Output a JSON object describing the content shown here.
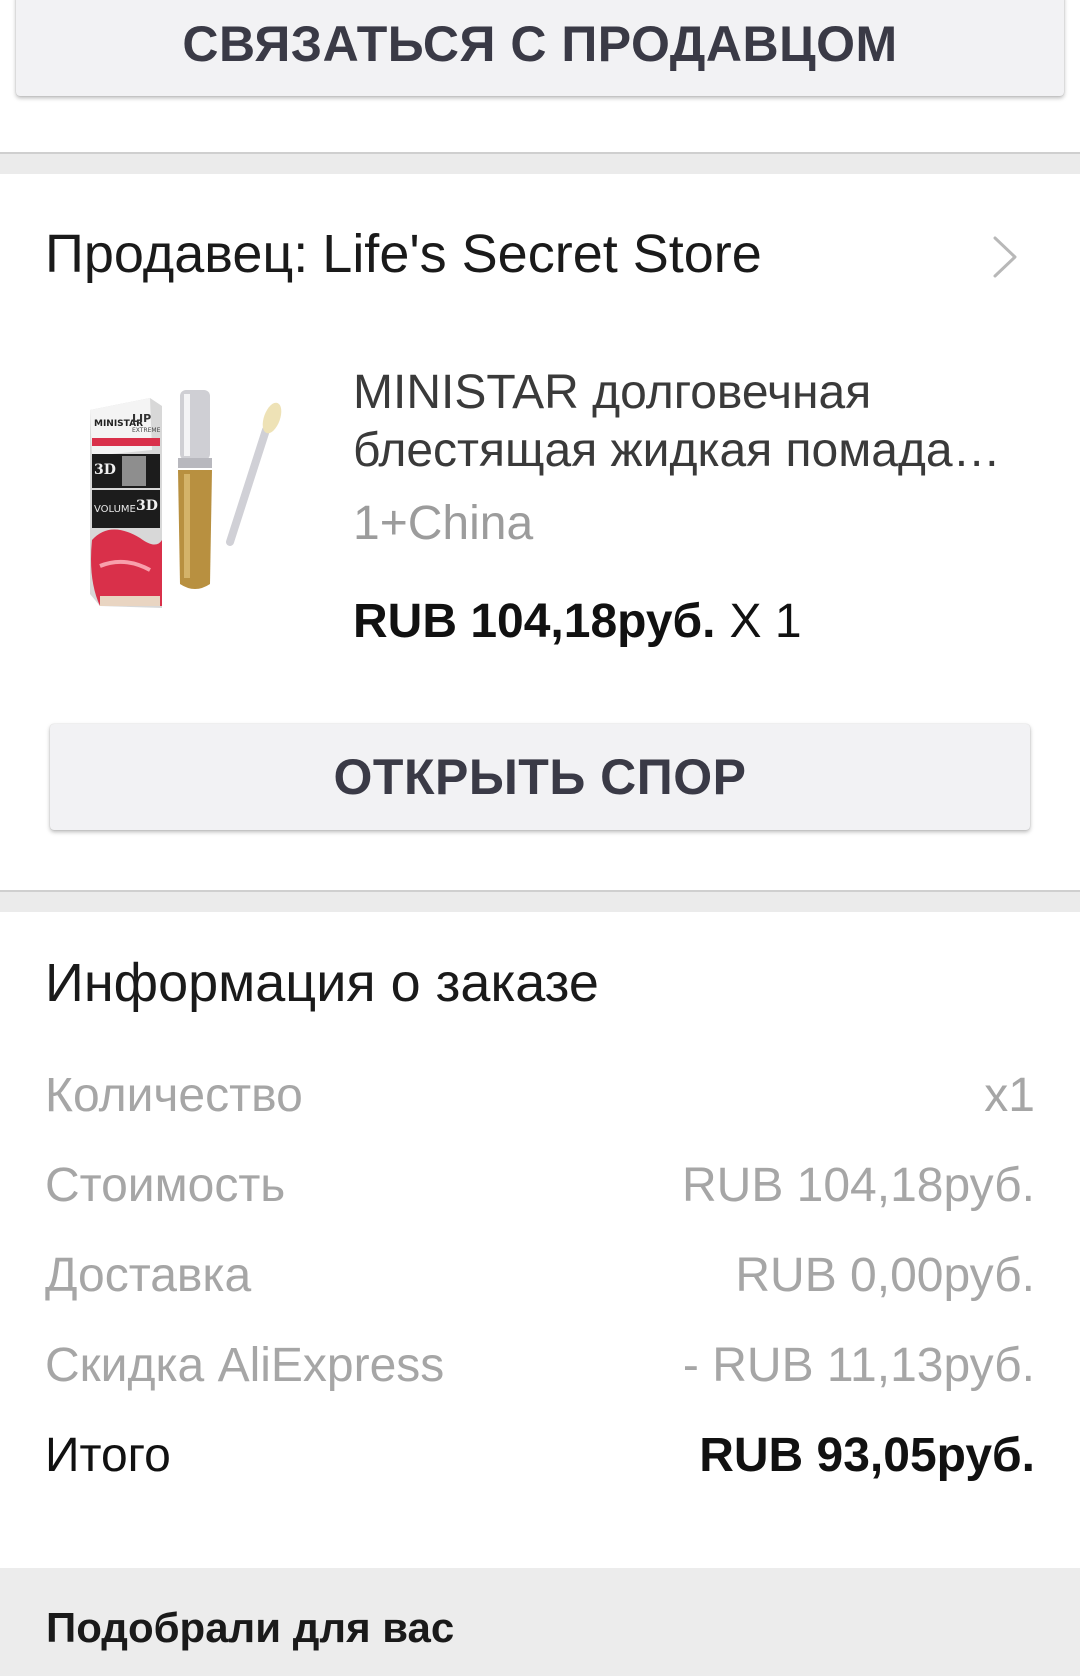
{
  "contact": {
    "button_label": "СВЯЗАТЬСЯ С ПРОДАВЦОМ"
  },
  "seller": {
    "prefix": "Продавец:",
    "name": "Life's Secret Store",
    "chevron_icon": "chevron-right-icon"
  },
  "product": {
    "image_icon": "product-thumbnail",
    "image_text": [
      "MINISTAR",
      "LIP",
      "EXTREME",
      "VOLUME",
      "3D"
    ],
    "title": "MINISTAR долговечная блестящая жидкая помада для губ с эффектом объема",
    "variant": "1+China",
    "price": "RUB 104,18руб.",
    "quantity": "X 1"
  },
  "dispute": {
    "button_label": "ОТКРЫТЬ СПОР"
  },
  "order_info": {
    "title": "Информация о заказе",
    "rows": [
      {
        "label": "Количество",
        "value": "x1"
      },
      {
        "label": "Стоимость",
        "value": "RUB 104,18руб."
      },
      {
        "label": "Доставка",
        "value": "RUB 0,00руб."
      },
      {
        "label": "Скидка AliExpress",
        "value": "- RUB 11,13руб."
      },
      {
        "label": "Итого",
        "value": "RUB 93,05руб."
      }
    ]
  },
  "recommendations": {
    "title": "Подобрали для вас"
  },
  "colors": {
    "background": "#ffffff",
    "divider": "#ebebeb",
    "button_bg": "#f2f2f4",
    "button_text": "#3a3a46",
    "muted_text": "#a6a6a6",
    "lip_red": "#d9304a",
    "gloss_gold": "#b89040"
  }
}
